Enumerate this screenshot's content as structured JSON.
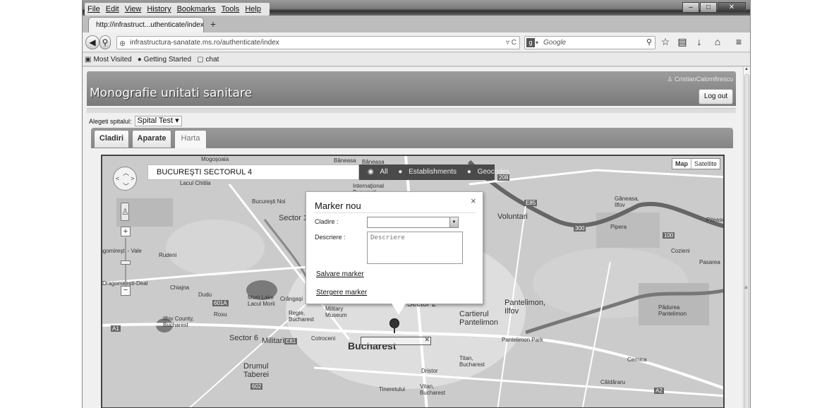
{
  "browser": {
    "menu": [
      "File",
      "Edit",
      "View",
      "History",
      "Bookmarks",
      "Tools",
      "Help"
    ],
    "tab_title": "http://infrastruct...uthenticate/index",
    "new_tab": "+",
    "url": "infrastructura-sanatate.ms.ro/authenticate/index",
    "search_placeholder": "Google",
    "bookmarks": [
      "Most Visited",
      "Getting Started",
      "chat"
    ]
  },
  "app": {
    "title": "Monografie unitati sanitare",
    "user": "CristianCalomfirescu",
    "logout_label": "Log out",
    "hospital_label": "Alegeti spitalul:",
    "hospital_value": "Spital Test",
    "tabs": [
      {
        "label": "Cladiri",
        "active": false
      },
      {
        "label": "Aparate",
        "active": false
      },
      {
        "label": "Harta",
        "active": true
      }
    ]
  },
  "map": {
    "search_text": "BUCUREŞTI SECTORUL 4",
    "filters": [
      "All",
      "Establishments",
      "Geocodes"
    ],
    "map_type": [
      "Map",
      "Satellite"
    ],
    "city_label": "Bucharest",
    "labels": [
      "Mogoşoaia",
      "Băneasa",
      "Băneasa",
      "Lacul Chitila",
      "Internaţional Bucureşti Băneasa",
      "Bucureşti Noi",
      "Sector 1",
      "Voluntari",
      "Găneasa, Ilfov",
      "Pipera",
      "Piteasc",
      "Dragomireşti - Vale",
      "Rudeni",
      "Cozieni",
      "Pasarea",
      "Dragomireşti-Deal",
      "Chiajna",
      "Dudu",
      "Morii Lake Lacul Morii",
      "Crângaşi",
      "Militari",
      "Rosu",
      "Regie, Bucharest",
      "Military Museum",
      "Sector 2",
      "Pantelimon, Ilfov",
      "Cartierul Pantelimon",
      "Pădurea Pantelimon",
      "Ilfov County, Bucharest",
      "Sector 6",
      "Cotroceni",
      "Pantelimon Park",
      "Titan, Bucharest",
      "Drumul Taberei",
      "Dristor",
      "Cernica",
      "Căldăraru",
      "Tineretului",
      "Vitan, Bucharest"
    ],
    "road_labels": [
      "A1",
      "A2",
      "E81",
      "E85",
      "300",
      "100",
      "601A",
      "602",
      "208"
    ]
  },
  "marker_popup": {
    "title": "Marker nou",
    "close": "×",
    "cladire_label": "Cladire :",
    "descriere_label": "Descriere :",
    "descriere_placeholder": "Descriere",
    "save_link": "Salvare marker",
    "delete_link": "Stergere marker"
  }
}
